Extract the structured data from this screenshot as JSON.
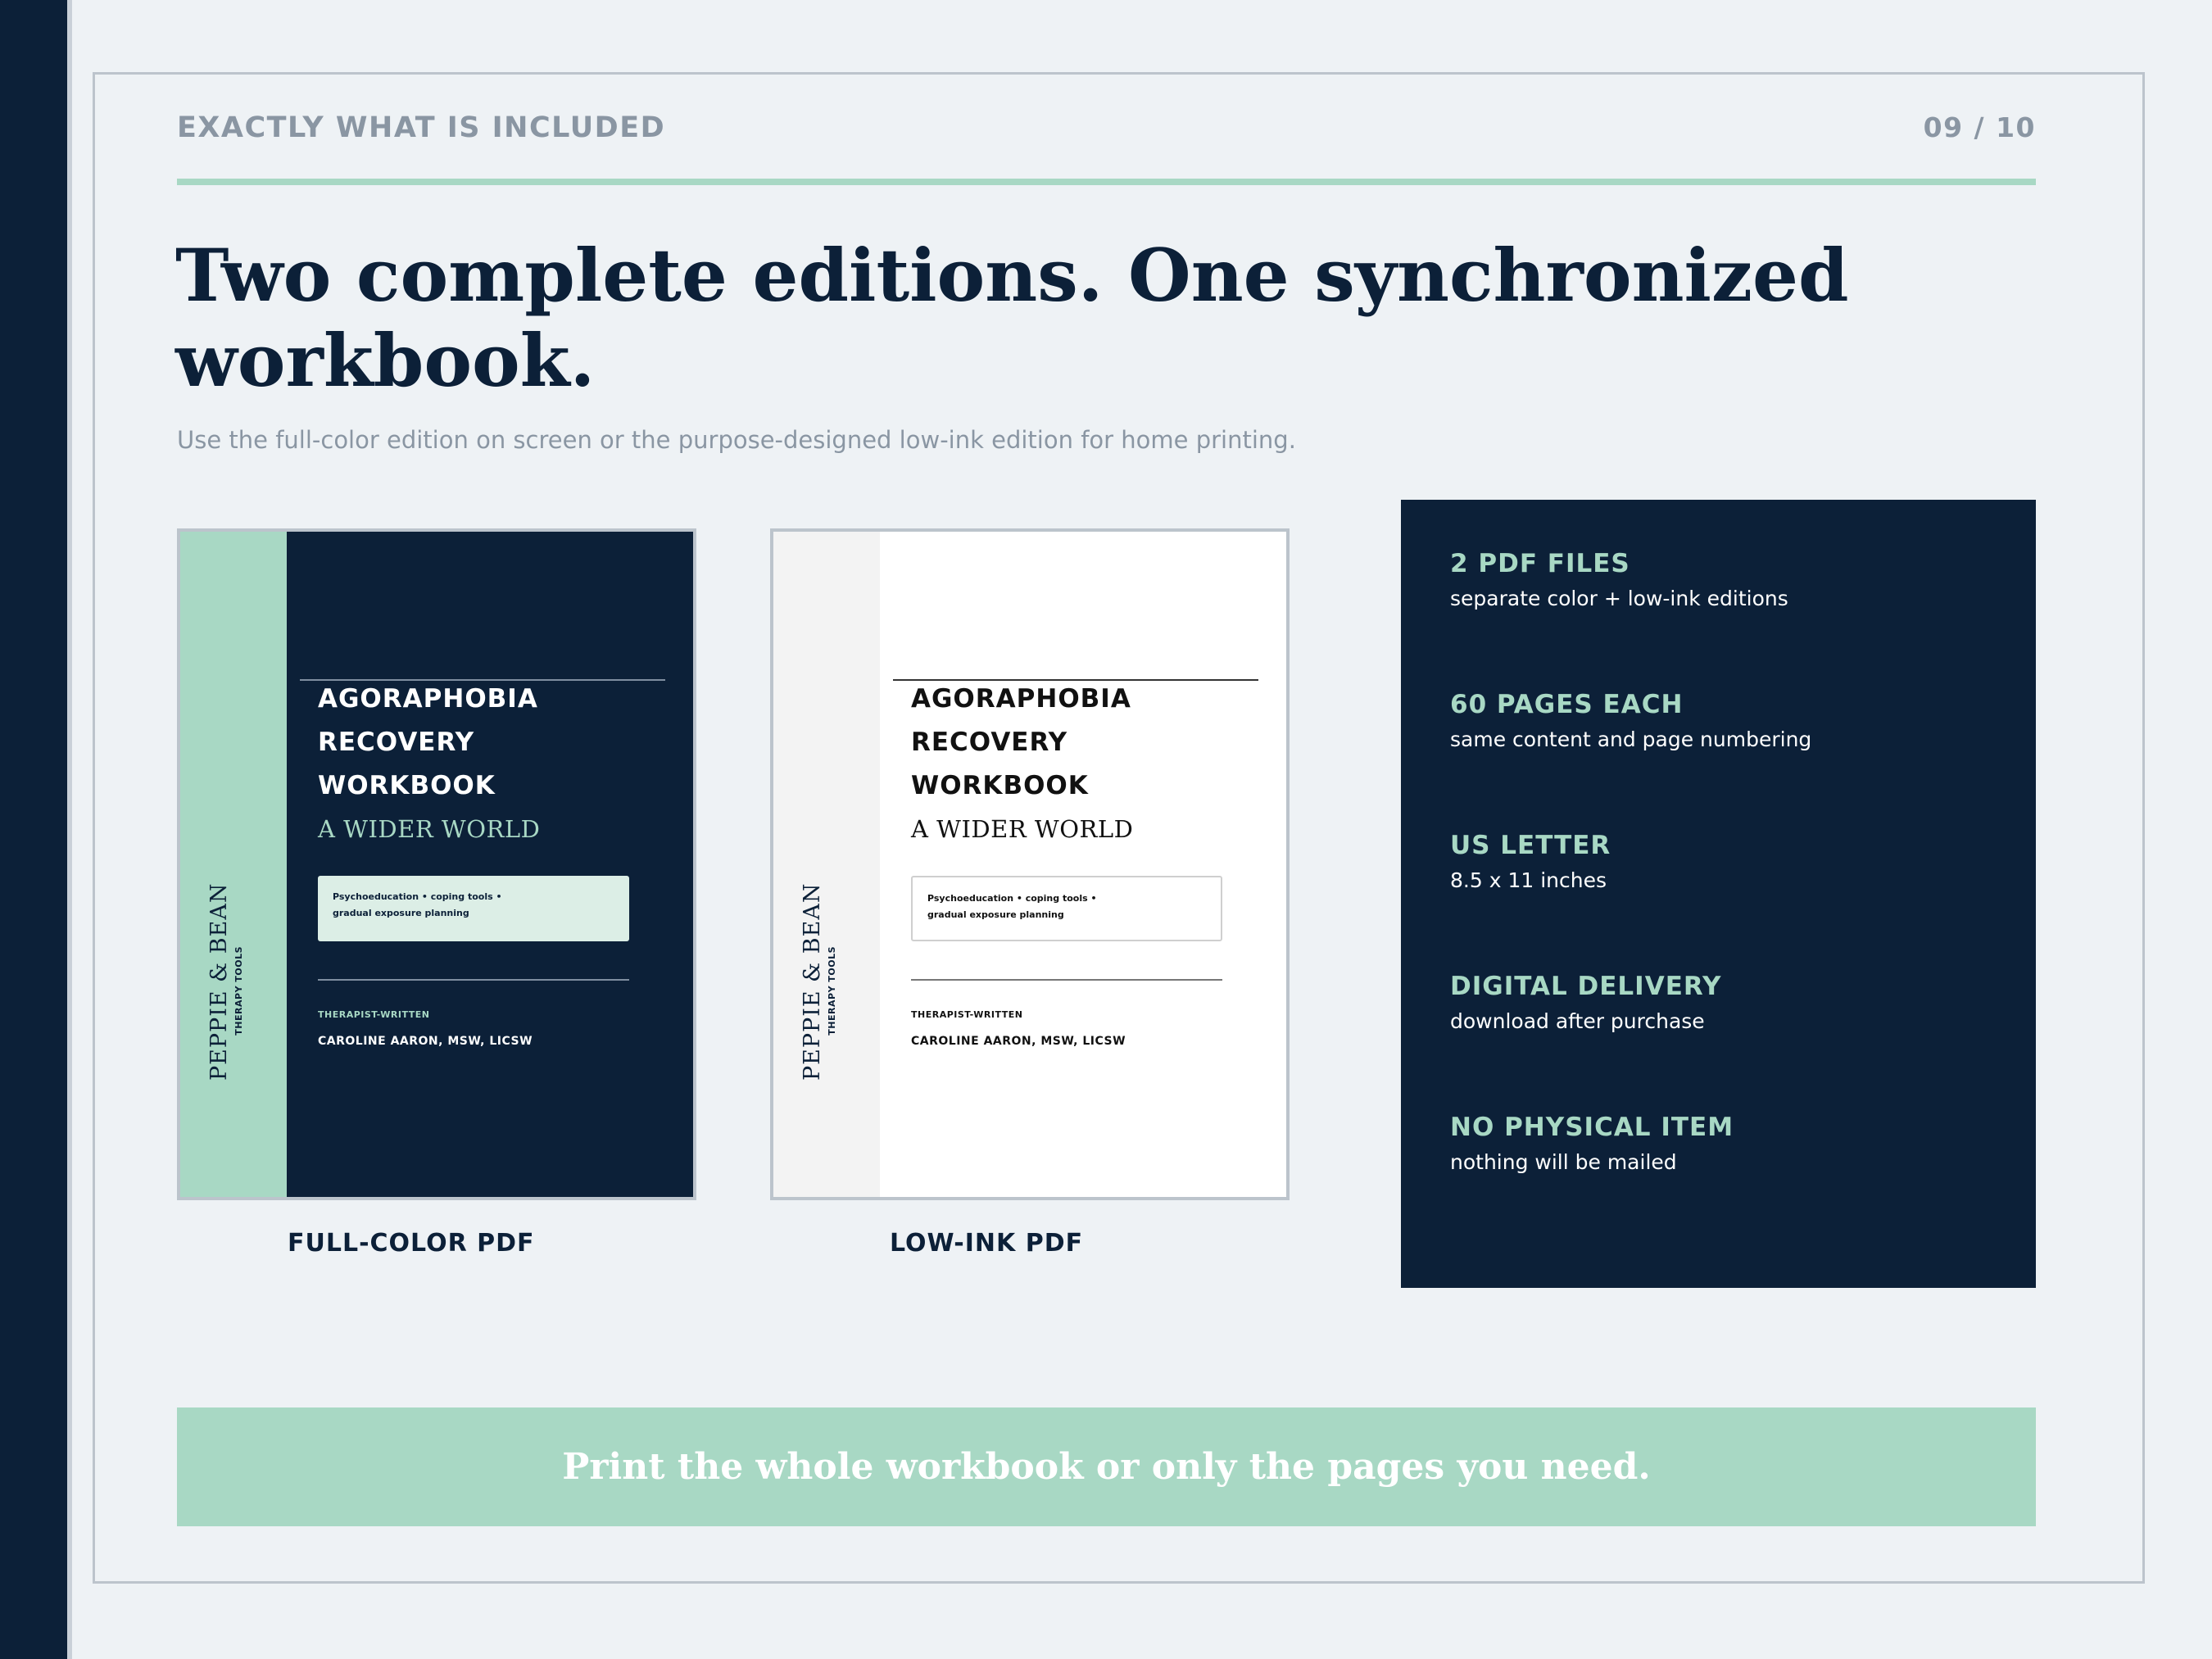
{
  "header": {
    "kicker": "EXACTLY WHAT IS INCLUDED",
    "page_indicator": "09 / 10"
  },
  "headline": "Two complete editions. One synchronized workbook.",
  "subhead": "Use the full-color edition on screen or the purpose-designed low-ink edition for home printing.",
  "covers": [
    {
      "caption": "FULL-COLOR PDF",
      "brand": "PEPPIE & BEAN",
      "brand_sub": "THERAPY TOOLS",
      "title_lines": [
        "AGORAPHOBIA",
        "RECOVERY",
        "WORKBOOK"
      ],
      "subtitle": "A WIDER WORLD",
      "box_lines": [
        "Psychoeducation • coping tools •",
        "gradual exposure planning"
      ],
      "tag": "THERAPIST-WRITTEN",
      "author": "CAROLINE AARON, MSW, LICSW"
    },
    {
      "caption": "LOW-INK PDF",
      "brand": "PEPPIE & BEAN",
      "brand_sub": "THERAPY TOOLS",
      "title_lines": [
        "AGORAPHOBIA",
        "RECOVERY",
        "WORKBOOK"
      ],
      "subtitle": "A WIDER WORLD",
      "box_lines": [
        "Psychoeducation • coping tools •",
        "gradual exposure planning"
      ],
      "tag": "THERAPIST-WRITTEN",
      "author": "CAROLINE AARON, MSW, LICSW"
    }
  ],
  "specs": [
    {
      "title": "2 PDF FILES",
      "desc": "separate color + low-ink editions"
    },
    {
      "title": "60 PAGES EACH",
      "desc": "same content and page numbering"
    },
    {
      "title": "US LETTER",
      "desc": "8.5 x 11 inches"
    },
    {
      "title": "DIGITAL DELIVERY",
      "desc": "download after purchase"
    },
    {
      "title": "NO PHYSICAL ITEM",
      "desc": "nothing will be mailed"
    }
  ],
  "banner": "Print the whole workbook or only the pages you need.",
  "colors": {
    "navy": "#0c2038",
    "mint": "#a8d8c4",
    "background": "#eef2f5",
    "muted_text": "#8a96a3"
  }
}
